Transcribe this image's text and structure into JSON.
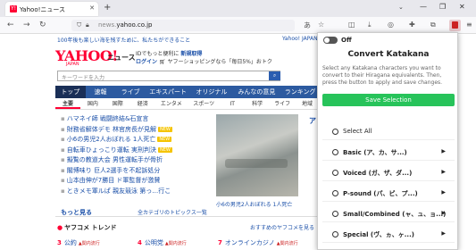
{
  "browser": {
    "tab_title": "Yahoo!ニュース",
    "tab_favicon": "Y!",
    "url_prefix": "news.",
    "url_domain": "yahoo.co.jp"
  },
  "page": {
    "promo_left": "100年後も楽しい海を残すために、私たちができること",
    "promo_right": "Yahoo! JAPAN",
    "logo": "YAHOO!",
    "logo_sub": "JAPAN",
    "logo_news": "ニュース",
    "login_text1": "IDでもっと便利に",
    "login_text1_link": "新規取得",
    "login_link": "ログイン",
    "login_text2": "ヤフーショッピングなら「毎日5%」おトク",
    "search_placeholder": "キーワードを入力",
    "category_tabs": [
      "トップ",
      "速報",
      "ライブ",
      "エキスパート",
      "オリジナル",
      "みんなの意見",
      "ランキング"
    ],
    "sub_categories": [
      "主要",
      "国内",
      "国際",
      "経済",
      "エンタメ",
      "スポーツ",
      "IT",
      "科学",
      "ライフ",
      "地域"
    ],
    "news": [
      {
        "text": "ハマネイ師 戦闘終結&石宣言",
        "badge": ""
      },
      {
        "text": "財務省解体デモ 林官房長が見解",
        "badge": "NEW"
      },
      {
        "text": "小6の男児2人おぼれる 1人死亡",
        "badge": "NEW"
      },
      {
        "text": "自転車ひょっこり運転 実刑判決",
        "badge": "NEW"
      },
      {
        "text": "擬覧の教道大会 男性運転手が骨折",
        "badge": ""
      },
      {
        "text": "閣博味り 巨人2選手を不起訴処分",
        "badge": ""
      },
      {
        "text": "山本由伸が7勝目 ド軍監督が激賛",
        "badge": ""
      },
      {
        "text": "ときメモ軍ルぱ 親友競泳 第っ…行こ",
        "badge": ""
      }
    ],
    "more_link": "もっと見る",
    "all_topics_link": "全カテゴリのトピックス一覧",
    "photo_caption": "小6の男児2人おぼれる 1人死亡",
    "edge_text": "ア",
    "trend_title": "ヤフコメ トレンド",
    "trend_right": "おすすめのヤフコメを見る",
    "trends": [
      {
        "rank": "3",
        "text": "公約",
        "tag": "▲関内流行"
      },
      {
        "rank": "4",
        "text": "公明党",
        "tag": "▲関内流行"
      },
      {
        "rank": "7",
        "text": "オンラインカジノ",
        "tag": "▲関内流行"
      }
    ]
  },
  "popup": {
    "toggle_label": "Off",
    "title": "Convert Katakana",
    "description": "Select any Katakana characters you want to convert to their Hiragana equivalents. Then, press the button to apply and save changes.",
    "save_button": "Save Selection",
    "options": [
      {
        "label": "Select All",
        "bold": false,
        "arrow": ""
      },
      {
        "label": "Basic (ア、カ、サ...)",
        "bold": true,
        "arrow": "▶"
      },
      {
        "label": "Voiced (ガ、ザ、ダ...)",
        "bold": true,
        "arrow": "▶"
      },
      {
        "label": "P-sound (パ、ピ、プ...)",
        "bold": true,
        "arrow": "▶"
      },
      {
        "label": "Small/Combined (ャ、ュ、ョ...)",
        "bold": true,
        "arrow": "▶"
      },
      {
        "label": "Special (ヴ、ヵ、ヶ...)",
        "bold": true,
        "arrow": "▶"
      }
    ]
  }
}
